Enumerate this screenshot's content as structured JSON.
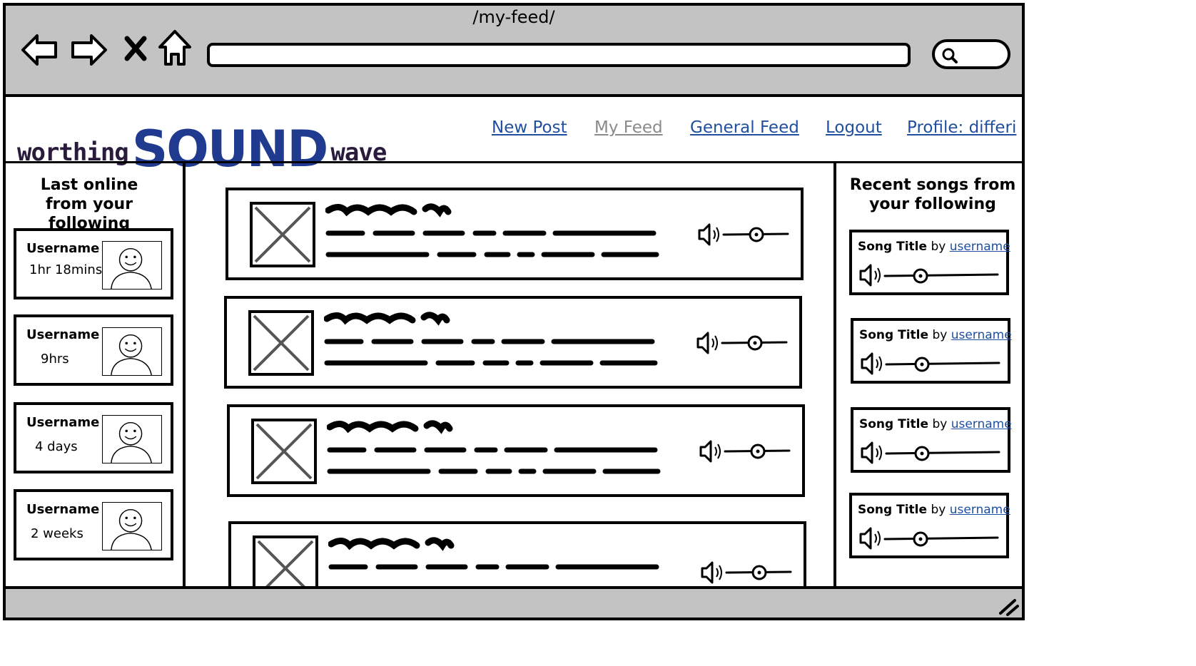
{
  "browser": {
    "address_title": "/my-feed/"
  },
  "logo": {
    "prefix": "worthing",
    "brand": "SOUND",
    "suffix": "wave"
  },
  "nav": {
    "links": [
      {
        "label": "New Post"
      },
      {
        "label": "My Feed",
        "active": true
      },
      {
        "label": "General Feed"
      },
      {
        "label": "Logout"
      },
      {
        "label": "Profile: differi"
      }
    ]
  },
  "left_panel": {
    "title_line1": "Last online",
    "title_line2": "from your following",
    "users": [
      {
        "name": "Username",
        "last_online": "1hr 18mins"
      },
      {
        "name": "Username",
        "last_online": "9hrs"
      },
      {
        "name": "Username",
        "last_online": "4 days"
      },
      {
        "name": "Username",
        "last_online": "2 weeks"
      }
    ]
  },
  "feed": {
    "post_count_visible": 4
  },
  "right_panel": {
    "title_line1": "Recent songs from",
    "title_line2": "your following",
    "songs": [
      {
        "title": "Song Title",
        "by": "by",
        "user": "username"
      },
      {
        "title": "Song Title",
        "by": "by",
        "user": "username"
      },
      {
        "title": "Song Title",
        "by": "by",
        "user": "username"
      },
      {
        "title": "Song Title",
        "by": "by",
        "user": "username"
      }
    ]
  },
  "colors": {
    "chrome": "#c3c3c3",
    "link": "#1f4f9e",
    "active_link": "#8a8a8a",
    "brand_blue": "#1f3a8f"
  },
  "icons": [
    "back-arrow-icon",
    "forward-arrow-icon",
    "close-icon",
    "home-icon",
    "search-icon",
    "speaker-icon",
    "resize-grip-icon"
  ]
}
